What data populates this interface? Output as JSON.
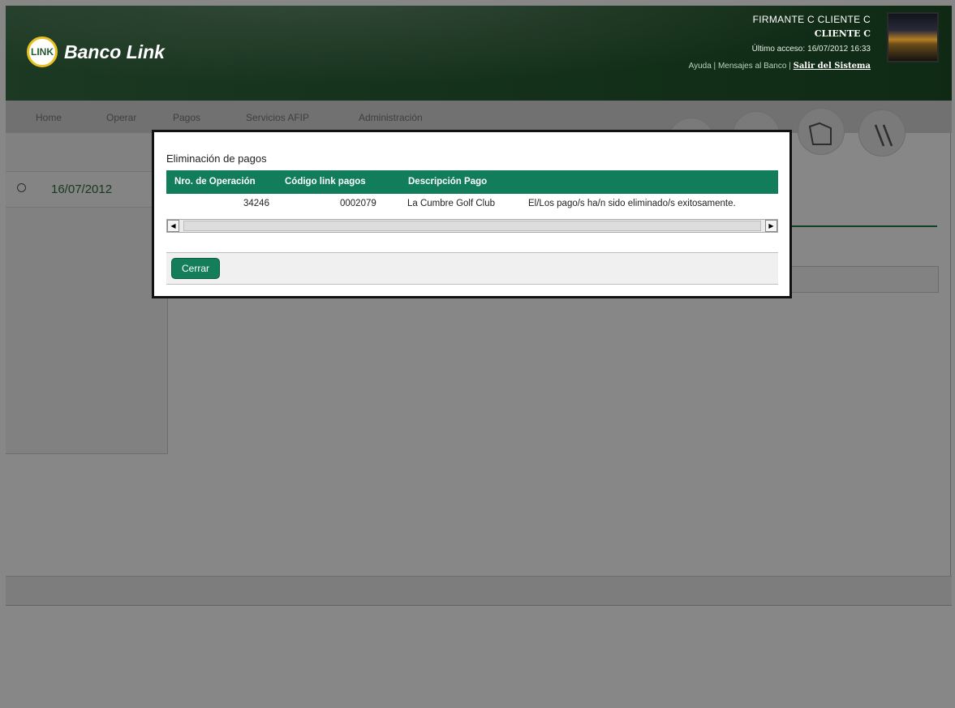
{
  "header": {
    "logo_badge": "LINK",
    "bank_name": "Banco Link",
    "user_name": "FIRMANTE C CLIENTE C",
    "client_name": "CLIENTE C",
    "last_access_label": "Último acceso:",
    "last_access_value": "16/07/2012 16:33",
    "links": {
      "help": "Ayuda",
      "sep": "|",
      "messages": "Mensajes al Banco",
      "logout": "Salir del Sistema"
    }
  },
  "nav": {
    "items": [
      {
        "label": "Home"
      },
      {
        "label": "Operar"
      },
      {
        "label": "Pagos"
      },
      {
        "label": "Servicios AFIP"
      },
      {
        "label": "Administración"
      }
    ]
  },
  "sidebar": {
    "date": "16/07/2012"
  },
  "dialog": {
    "title": "Eliminación de pagos",
    "columns": [
      "Nro. de Operación",
      "Código link pagos",
      "Descripción Pago",
      ""
    ],
    "rows": [
      {
        "operation": "34246",
        "code": "0002079",
        "description": "La Cumbre Golf Club",
        "result": "El/Los pago/s ha/n sido eliminado/s exitosamente."
      }
    ],
    "close_label": "Cerrar"
  },
  "colors": {
    "header_green": "#245a30",
    "table_header": "#117d5b",
    "button_green": "#147d5a",
    "date_green": "#2d6c3b"
  }
}
